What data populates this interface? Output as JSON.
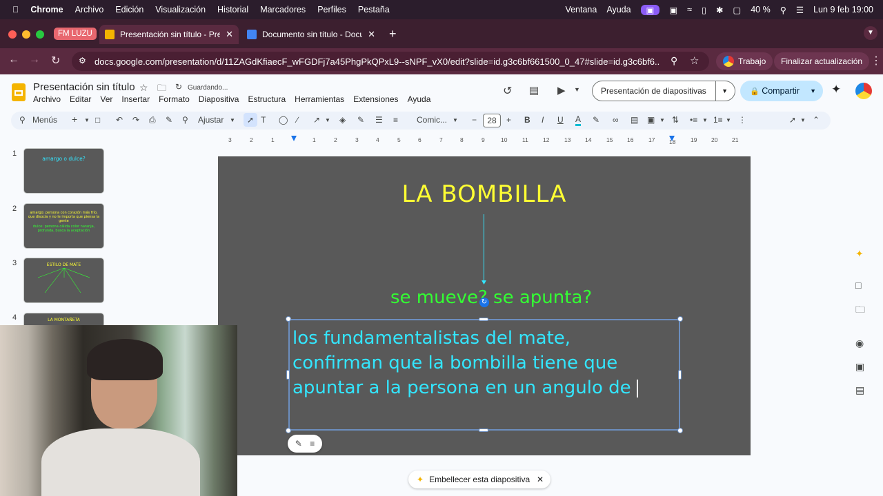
{
  "menubar": {
    "items": [
      "Chrome",
      "Archivo",
      "Edición",
      "Visualización",
      "Historial",
      "Marcadores",
      "Perfiles",
      "Pestaña"
    ],
    "right_items": [
      "Ventana",
      "Ayuda"
    ],
    "battery": "40 %",
    "clock": "Lun 9 feb 19:00"
  },
  "tabs": {
    "pinned": "FM LUZU",
    "items": [
      {
        "label": "Presentación sin título - Prese",
        "active": true,
        "icon_color": "#f4b400"
      },
      {
        "label": "Documento sin título - Docum",
        "active": false,
        "icon_color": "#4285f4"
      }
    ],
    "new_tab": "+"
  },
  "address": {
    "url": "docs.google.com/presentation/d/11ZAGdKfiaecF_wFGDFj7a45PhgPkQPxL9--sNPF_vX0/edit?slide=id.g3c6bf661500_0_47#slide=id.g3c6bf6...",
    "profile": "Trabajo",
    "update": "Finalizar actualización"
  },
  "docs": {
    "title": "Presentación sin título",
    "saving": "Guardando...",
    "menus": [
      "Archivo",
      "Editar",
      "Ver",
      "Insertar",
      "Formato",
      "Diapositiva",
      "Estructura",
      "Herramientas",
      "Extensiones",
      "Ayuda"
    ],
    "slideshow": "Presentación de diapositivas",
    "share": "Compartir"
  },
  "toolbar": {
    "menus": "Menús",
    "fit": "Ajustar",
    "font": "Comic...",
    "font_size": "28"
  },
  "ruler": {
    "ticks": [
      "3",
      "2",
      "1",
      "1",
      "2",
      "3",
      "4",
      "5",
      "6",
      "7",
      "8",
      "9",
      "10",
      "11",
      "12",
      "13",
      "14",
      "15",
      "16",
      "17",
      "18",
      "19",
      "20",
      "21"
    ]
  },
  "sidebar": {
    "slides": [
      {
        "num": "1",
        "text": "amargo o dulce?"
      },
      {
        "num": "2",
        "text": "amargo: persona con corazón más frío, que disocia y no le importa que piensa la gente"
      },
      {
        "num": "3",
        "text": "ESTILO DE MATE"
      },
      {
        "num": "4",
        "text": "LA MONTAÑETA"
      }
    ],
    "slide2_line2": "dulce: persona cálida color naranja, profunda, busca la aceptación"
  },
  "slide": {
    "title": "LA BOMBILLA",
    "subtitle": "se mueve? se apunta?",
    "body_lines": [
      "los fundamentalistas del mate,",
      "confirman que la bombilla tiene que",
      "apuntar a la persona en un angulo de"
    ]
  },
  "beautify": {
    "label": "Embellecer esta diapositiva"
  },
  "colors": {
    "slide_bg": "#595959",
    "title": "#ffff33",
    "subtitle": "#33ff33",
    "body": "#33e6ff",
    "share_bg": "#c2e7ff"
  }
}
